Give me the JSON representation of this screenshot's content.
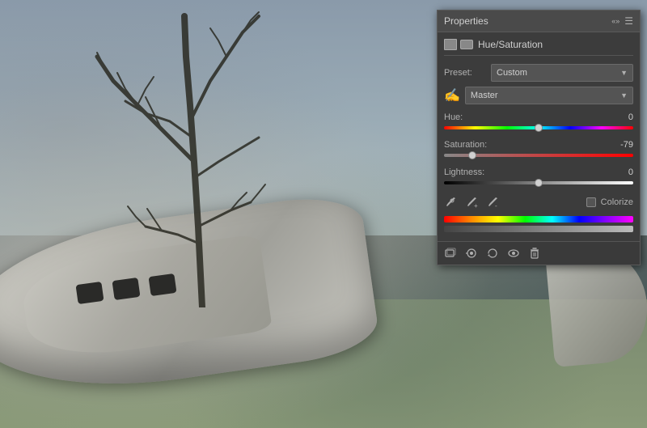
{
  "background": {
    "alt": "Crashed airplane with dead tree"
  },
  "panel": {
    "title": "Properties",
    "section_title": "Hue/Saturation",
    "preset_label": "Preset:",
    "preset_value": "Custom",
    "channel_label": "",
    "channel_value": "Master",
    "hue_label": "Hue:",
    "hue_value": "0",
    "hue_percent": 50,
    "saturation_label": "Saturation:",
    "saturation_value": "-79",
    "saturation_percent": 15,
    "lightness_label": "Lightness:",
    "lightness_value": "0",
    "lightness_percent": 50,
    "colorize_label": "Colorize",
    "footer_icons": [
      "clip-icon",
      "eye-dotted-icon",
      "history-icon",
      "eye-icon",
      "trash-icon"
    ]
  }
}
